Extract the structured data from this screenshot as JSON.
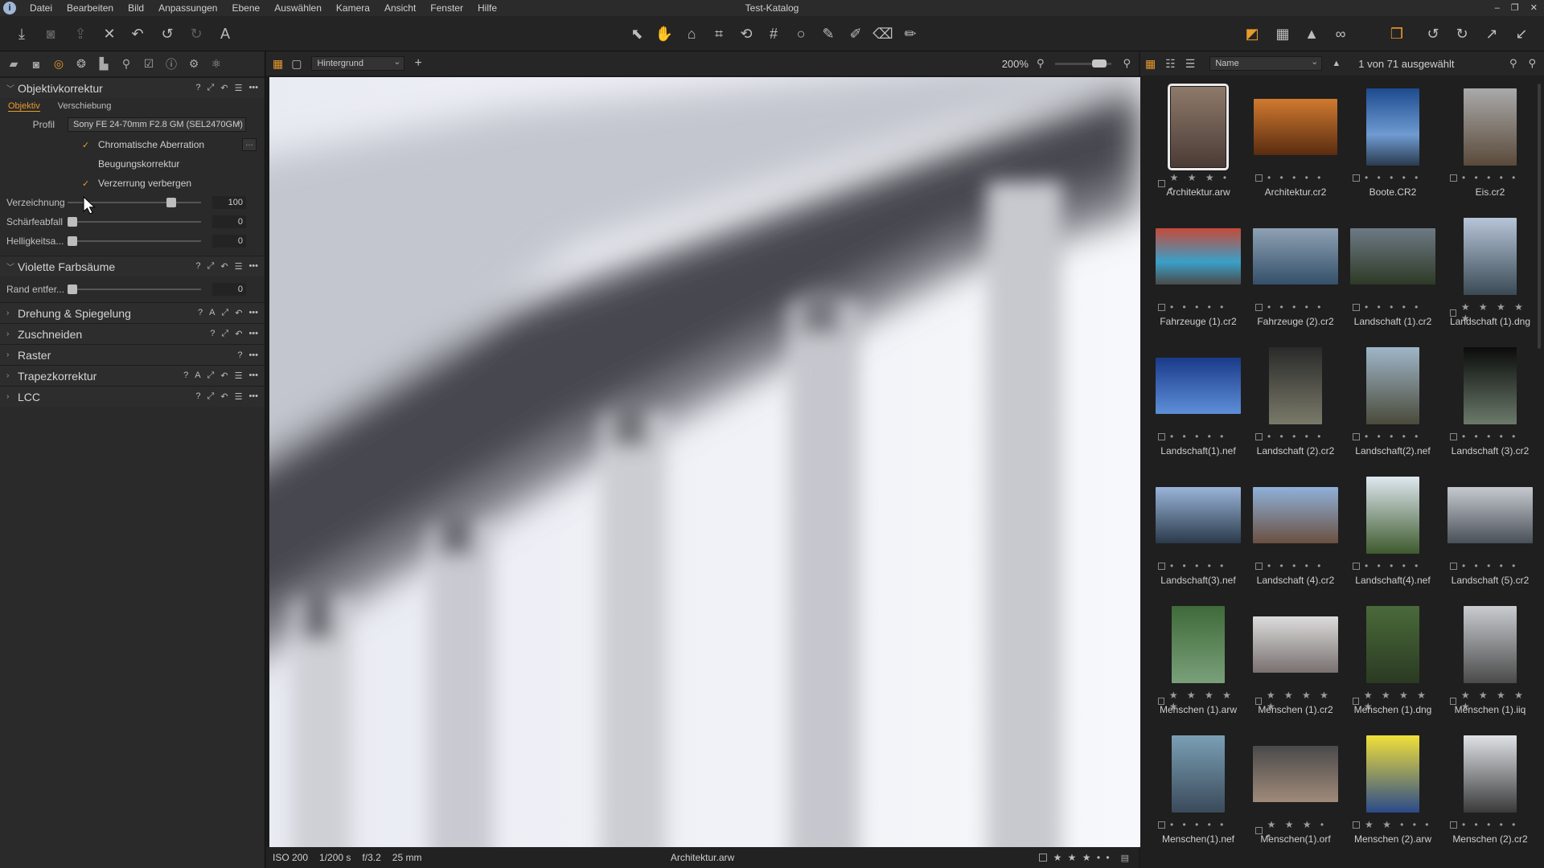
{
  "app": {
    "title": "Test-Katalog"
  },
  "menu": [
    "Datei",
    "Bearbeiten",
    "Bild",
    "Anpassungen",
    "Ebene",
    "Auswählen",
    "Kamera",
    "Ansicht",
    "Fenster",
    "Hilfe"
  ],
  "left_panel": {
    "sections": {
      "lens": {
        "title": "Objektivkorrektur",
        "subtabs": [
          "Objektiv",
          "Verschiebung"
        ],
        "profile_label": "Profil",
        "profile_value": "Sony FE 24-70mm F2.8 GM (SEL2470GM)",
        "checks": [
          {
            "label": "Chromatische Aberration",
            "checked": true
          },
          {
            "label": "Beugungskorrektur",
            "checked": false
          },
          {
            "label": "Verzerrung verbergen",
            "checked": true
          }
        ],
        "sliders": [
          {
            "label": "Verzeichnung",
            "value": "100",
            "level": 0.8
          },
          {
            "label": "Schärfeabfall",
            "value": "0",
            "level": 0.0
          },
          {
            "label": "Helligkeitsa...",
            "value": "0",
            "level": 0.0
          }
        ]
      },
      "fringe": {
        "title": "Violette Farbsäume",
        "slider": {
          "label": "Rand entfer...",
          "value": "0",
          "level": 0.0
        }
      },
      "collapsed": [
        "Drehung & Spiegelung",
        "Zuschneiden",
        "Raster",
        "Trapezkorrektur",
        "LCC"
      ]
    }
  },
  "viewer": {
    "layer": "Hintergrund",
    "zoom": "200%",
    "status": {
      "iso": "ISO 200",
      "shutter": "1/200 s",
      "aperture": "f/3.2",
      "focal": "25 mm",
      "filename": "Architektur.arw",
      "stars": "★ ★ ★ • •"
    }
  },
  "browser": {
    "sort": "Name",
    "selection": "1 von 71 ausgewählt",
    "items": [
      {
        "name": "Architektur.arw",
        "stars": "★ ★ ★ • •",
        "selected": true
      },
      {
        "name": "Architektur.cr2",
        "stars": "• • • • •"
      },
      {
        "name": "Boote.CR2",
        "stars": "• • • • •"
      },
      {
        "name": "Eis.cr2",
        "stars": "• • • • •"
      },
      {
        "name": "Fahrzeuge (1).cr2",
        "stars": "• • • • •"
      },
      {
        "name": "Fahrzeuge (2).cr2",
        "stars": "• • • • •"
      },
      {
        "name": "Landschaft (1).cr2",
        "stars": "• • • • •"
      },
      {
        "name": "Landschaft (1).dng",
        "stars": "★ ★ ★ ★ ★"
      },
      {
        "name": "Landschaft(1).nef",
        "stars": "• • • • •"
      },
      {
        "name": "Landschaft (2).cr2",
        "stars": "• • • • •"
      },
      {
        "name": "Landschaft(2).nef",
        "stars": "• • • • •"
      },
      {
        "name": "Landschaft (3).cr2",
        "stars": "• • • • •"
      },
      {
        "name": "Landschaft(3).nef",
        "stars": "• • • • •"
      },
      {
        "name": "Landschaft (4).cr2",
        "stars": "• • • • •"
      },
      {
        "name": "Landschaft(4).nef",
        "stars": "• • • • •"
      },
      {
        "name": "Landschaft (5).cr2",
        "stars": "• • • • •"
      },
      {
        "name": "Menschen (1).arw",
        "stars": "★ ★ ★ ★ ★"
      },
      {
        "name": "Menschen (1).cr2",
        "stars": "★ ★ ★ ★ ★"
      },
      {
        "name": "Menschen (1).dng",
        "stars": "★ ★ ★ ★ ★"
      },
      {
        "name": "Menschen (1).iiq",
        "stars": "★ ★ ★ ★ ★"
      },
      {
        "name": "Menschen(1).nef",
        "stars": "• • • • •"
      },
      {
        "name": "Menschen(1).orf",
        "stars": "★ ★ ★ • •"
      },
      {
        "name": "Menschen (2).arw",
        "stars": "★ ★ • • •"
      },
      {
        "name": "Menschen (2).cr2",
        "stars": "• • • • •"
      }
    ]
  },
  "colors": {
    "accent": "#e89a2c",
    "panel": "#2a2a2a",
    "background": "#1b1b1b"
  }
}
